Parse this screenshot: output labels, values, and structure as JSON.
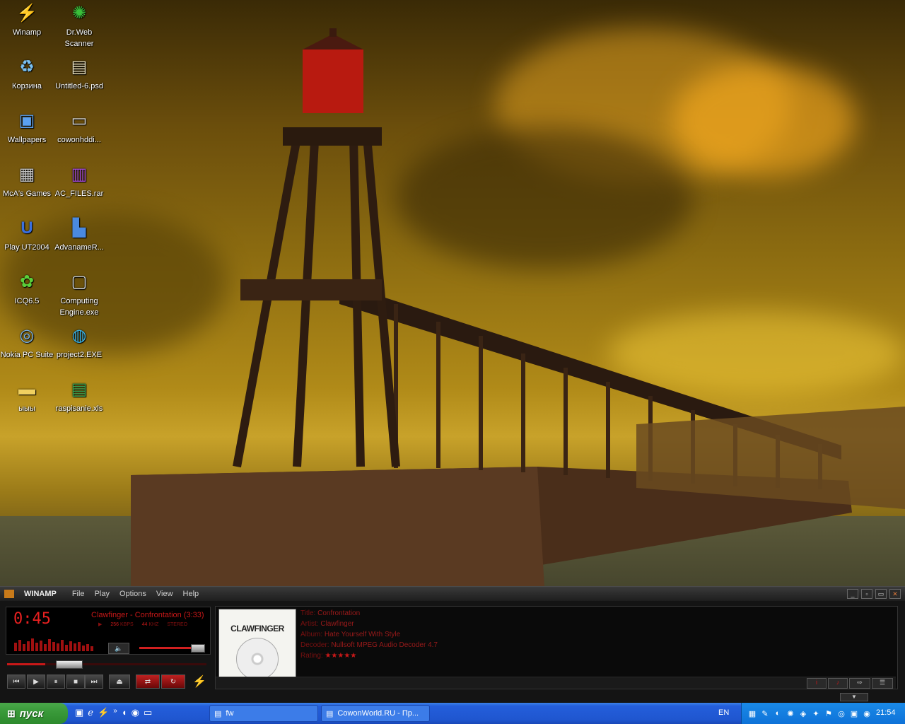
{
  "desktop": {
    "icons": [
      {
        "label": "Winamp",
        "icon": "winamp-icon"
      },
      {
        "label": "Dr.Web Scanner",
        "icon": "drweb-icon"
      },
      {
        "label": "Корзина",
        "icon": "recycle-bin-icon"
      },
      {
        "label": "Untitled-6.psd",
        "icon": "psd-file-icon"
      },
      {
        "label": "Wallpapers",
        "icon": "wallpapers-icon"
      },
      {
        "label": "cowonhddi...",
        "icon": "monitor-icon"
      },
      {
        "label": "McA's Games",
        "icon": "games-icon"
      },
      {
        "label": "AC_FILES.rar",
        "icon": "rar-file-icon"
      },
      {
        "label": "Play UT2004",
        "icon": "ut2004-icon"
      },
      {
        "label": "AdvanameR...",
        "icon": "advaname-icon"
      },
      {
        "label": "ICQ6.5",
        "icon": "icq-icon"
      },
      {
        "label": "Computing Engine.exe",
        "icon": "computer-icon"
      },
      {
        "label": "Nokia PC Suite",
        "icon": "nokia-icon"
      },
      {
        "label": "project2.EXE",
        "icon": "globe-icon"
      },
      {
        "label": "ыыы",
        "icon": "folder-icon"
      },
      {
        "label": "raspisanie.xls",
        "icon": "excel-icon"
      }
    ]
  },
  "winamp": {
    "brand": "WINAMP",
    "menu": [
      "File",
      "Play",
      "Options",
      "View",
      "Help"
    ],
    "time": "0:45",
    "track": "Clawfinger - Confrontation (3:33)",
    "bitrate": "256",
    "bitrate_unit": "KBPS",
    "khz": "44",
    "khz_unit": "KHZ",
    "channels": "STEREO",
    "seek_position": 0.19,
    "volume_level": 0.88,
    "info": {
      "title_key": "Title:",
      "title": "Confrontation",
      "artist_key": "Artist:",
      "artist": "Clawfinger",
      "album_key": "Album:",
      "album": "Hate Yourself With Style",
      "decoder_key": "Decoder:",
      "decoder": "Nullsoft MPEG Audio Decoder 4.7",
      "rating_key": "Rating:",
      "rating": "★★★★★"
    },
    "album_art_text": "CLAWFINGER"
  },
  "taskbar": {
    "start_label": "пуск",
    "tasks": [
      "fw",
      "CowonWorld.RU - Пр..."
    ],
    "language": "EN",
    "clock": "21:54"
  }
}
